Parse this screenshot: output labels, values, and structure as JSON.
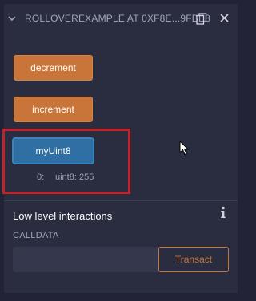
{
  "contract": {
    "title": "ROLLOVEREXAMPLE AT 0XF8E...9FBE8"
  },
  "functions": {
    "decrement_label": "decrement",
    "increment_label": "increment",
    "call_label": "myUint8"
  },
  "result": {
    "index": "0:",
    "value": "uint8: 255"
  },
  "low_level": {
    "title": "Low level interactions",
    "calldata_label": "CALLDATA",
    "calldata_value": "",
    "transact_label": "Transact"
  },
  "icons": {
    "header": [
      "chevron-down-icon",
      "copy-icon",
      "close-icon"
    ],
    "info": "info-icon",
    "pointer": "cursor-icon"
  },
  "colors": {
    "panel_bg": "#2a2c3f",
    "page_bg": "#222336",
    "transact_button": "#c97539",
    "call_button": "#2f6fa3",
    "highlight": "#c0242b"
  }
}
